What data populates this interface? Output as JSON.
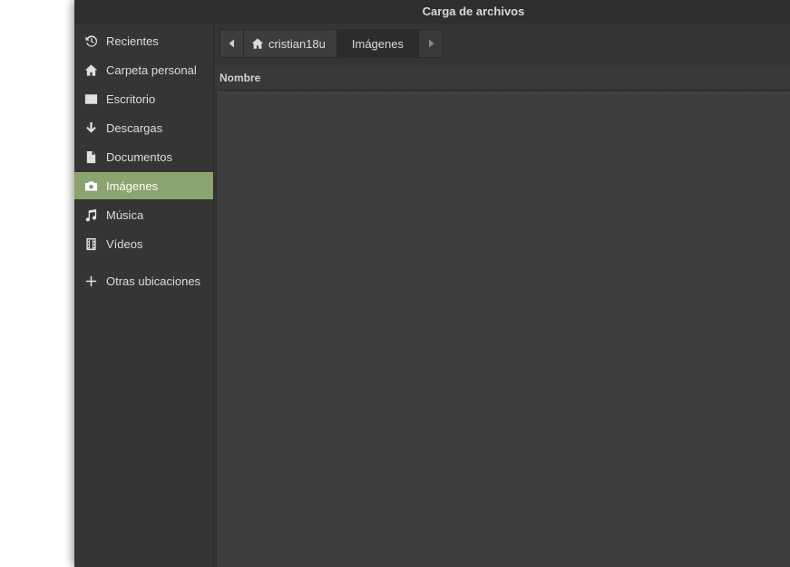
{
  "window": {
    "title": "Carga de archivos"
  },
  "sidebar": {
    "items": [
      {
        "label": "Recientes",
        "icon": "clock-history-icon"
      },
      {
        "label": "Carpeta personal",
        "icon": "home-icon"
      },
      {
        "label": "Escritorio",
        "icon": "desktop-icon"
      },
      {
        "label": "Descargas",
        "icon": "download-arrow-icon"
      },
      {
        "label": "Documentos",
        "icon": "document-icon"
      },
      {
        "label": "Imágenes",
        "icon": "camera-icon",
        "active": true
      },
      {
        "label": "Música",
        "icon": "music-note-icon"
      },
      {
        "label": "Vídeos",
        "icon": "film-icon"
      },
      {
        "label": "Otras ubicaciones",
        "icon": "plus-icon"
      }
    ]
  },
  "pathbar": {
    "home_label": "cristian18u",
    "current_label": "Imágenes"
  },
  "filelist": {
    "column_name": "Nombre"
  },
  "colors": {
    "accent": "#8aa36f",
    "background": "#353535",
    "file_area": "#3e3e3e"
  }
}
